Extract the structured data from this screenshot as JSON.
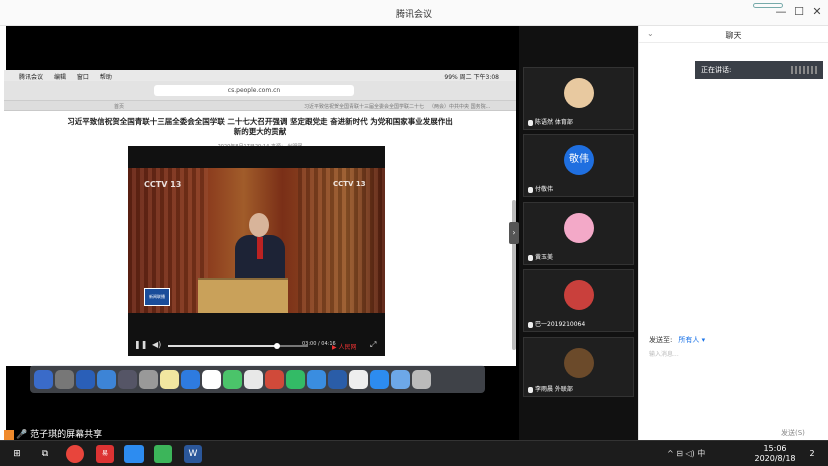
{
  "window": {
    "title": "腾讯会议",
    "controls": {
      "minimize": "—",
      "maximize": "☐",
      "close": "✕"
    }
  },
  "mac": {
    "menu": [
      "",
      "腾讯会议",
      "编辑",
      "窗口",
      "帮助"
    ],
    "status_right": "99%  周二 下午3:08",
    "url": "cs.people.com.cn",
    "tabs": [
      "首页",
      "习近平致信祝贺全国青联十三届全委会全国学联二十七大召开",
      "（两会）中共中央 国务院..."
    ]
  },
  "article": {
    "headline": "习近平致信祝贺全国青联十三届全委会全国学联 二十七大召开强调 坚定跟党走 奋进新时代 为党和国家事业发展作出新的更大的贡献",
    "meta": "2020年8月17日20:14    来源：  光明网"
  },
  "player": {
    "progress": 0.78,
    "time": "03:00 / 04:16",
    "channel_logo": "CCTV 13",
    "watermark": "新闻联播"
  },
  "share": {
    "label": "范子琪的屏幕共享"
  },
  "participants": [
    {
      "name": "陈语然 体育部",
      "avatar": "photo",
      "color": "#e8c9a0"
    },
    {
      "name": "付敬伟",
      "avatar": "敬伟",
      "color": "#1f6fe0"
    },
    {
      "name": "黄玉美",
      "avatar": "cartoon",
      "color": "#f3a9c8"
    },
    {
      "name": "巴一2019210064",
      "avatar": "track",
      "color": "#c9403c"
    },
    {
      "name": "李雨晨 外联部",
      "avatar": "guitar",
      "color": "#6b4a2a"
    }
  ],
  "chat": {
    "title": "聊天",
    "speaking_label": "正在讲话:",
    "send_to_label": "发送至:",
    "send_to_value": "所有人 ▾",
    "input_placeholder": "输入消息...",
    "send_button": "发送(S)"
  },
  "taskbar": {
    "tray": "^  ⊟  ◁)  中",
    "time": "15:06",
    "date": "2020/8/18",
    "notification_count": "2"
  }
}
